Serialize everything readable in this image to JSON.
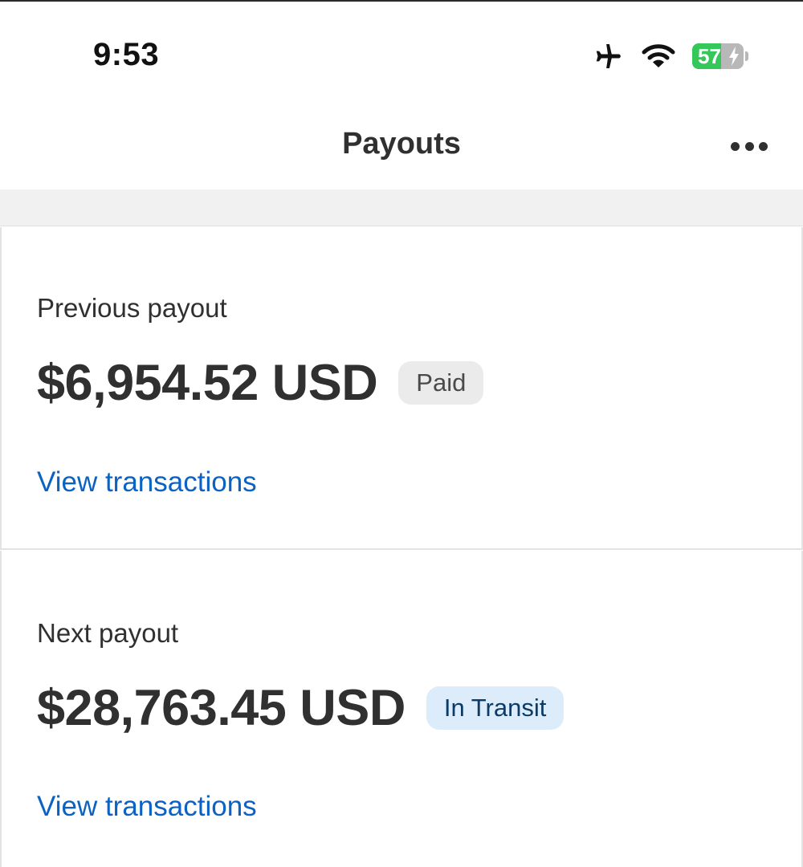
{
  "status_bar": {
    "time": "9:53",
    "icons": [
      "airplane-icon",
      "wifi-icon",
      "battery-icon"
    ],
    "battery_level": "57",
    "battery_fraction": 0.57,
    "battery_color": "#34c759"
  },
  "header": {
    "title": "Payouts",
    "more_icon": "ellipsis-icon"
  },
  "payouts": {
    "previous": {
      "label": "Previous payout",
      "amount": "$6,954.52 USD",
      "status": "Paid",
      "link": "View transactions"
    },
    "next": {
      "label": "Next payout",
      "amount": "$28,763.45 USD",
      "status": "In Transit",
      "link": "View transactions"
    }
  },
  "colors": {
    "link": "#0a62c2",
    "paid_badge_bg": "#ebebeb",
    "transit_badge_bg": "#dcecfb"
  }
}
